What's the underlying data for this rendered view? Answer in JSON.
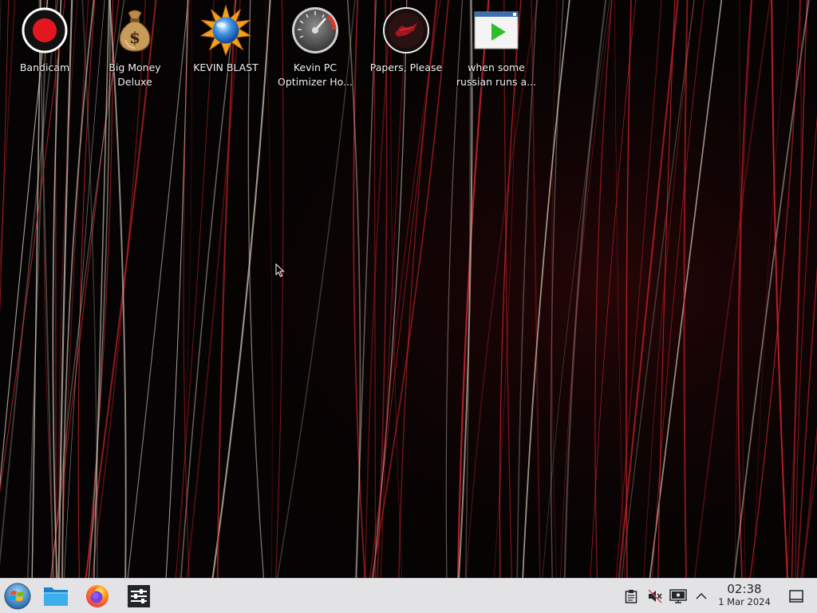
{
  "desktop": {
    "icons": [
      {
        "name": "bandicam",
        "label": "Bandicam",
        "icon": "bandicam-record-icon"
      },
      {
        "name": "big-money-deluxe",
        "label": "Big Money\nDeluxe",
        "icon": "money-bag-icon"
      },
      {
        "name": "kevin-blast",
        "label": "KEVIN BLAST",
        "icon": "sun-globe-icon"
      },
      {
        "name": "kevin-pc-optimizer",
        "label": "Kevin PC\nOptimizer Ho...",
        "icon": "speedometer-icon"
      },
      {
        "name": "papers-please",
        "label": "Papers, Please",
        "icon": "papers-please-seal-icon"
      },
      {
        "name": "when-some-russian",
        "label": "when some\nrussian runs a...",
        "icon": "video-play-icon"
      }
    ]
  },
  "taskbar": {
    "launchers": [
      {
        "name": "start-menu",
        "icon": "windows-orb-icon"
      },
      {
        "name": "file-manager",
        "icon": "folder-icon"
      },
      {
        "name": "firefox",
        "icon": "firefox-icon"
      },
      {
        "name": "system-settings",
        "icon": "settings-sliders-icon"
      }
    ],
    "tray": [
      {
        "name": "clipboard",
        "icon": "clipboard-icon"
      },
      {
        "name": "volume-muted",
        "icon": "speaker-muted-icon"
      },
      {
        "name": "display",
        "icon": "monitor-icon"
      },
      {
        "name": "show-hidden",
        "icon": "chevron-up-icon"
      }
    ],
    "clock": {
      "time": "02:38",
      "date": "1 Mar 2024"
    },
    "show_desktop_icon": "show-desktop-icon"
  },
  "colors": {
    "taskbar_bg": "#e3e3e6",
    "wallpaper_bg": "#050303",
    "streak_red": "#d8262c",
    "streak_pale": "#c9c2b4"
  }
}
